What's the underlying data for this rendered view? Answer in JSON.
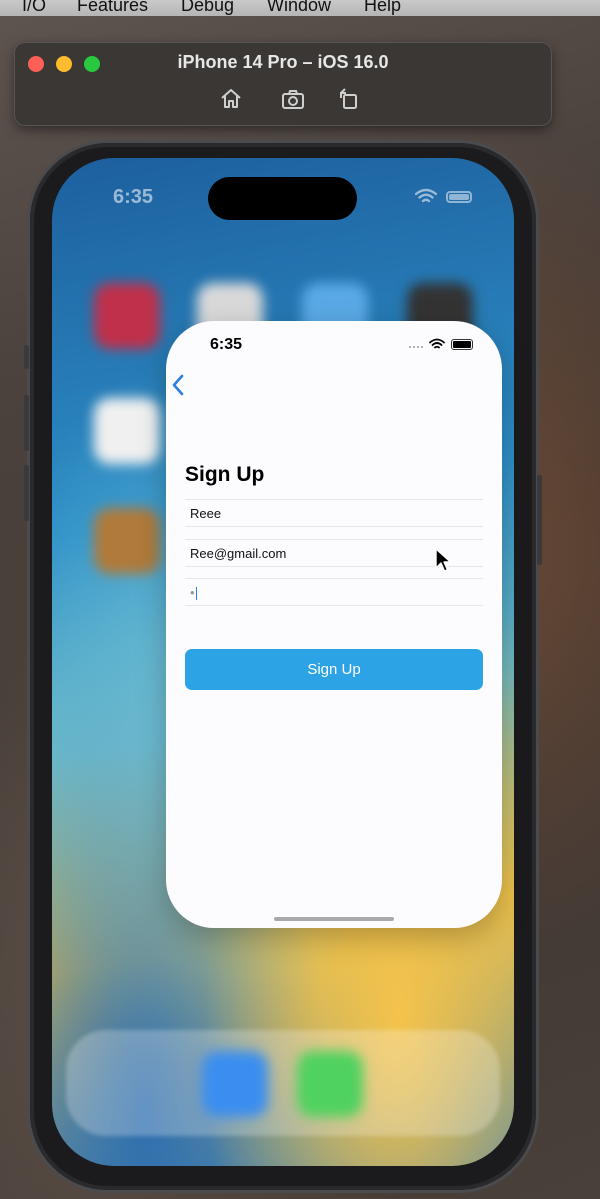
{
  "menubar": {
    "items": [
      "I/O",
      "Features",
      "Debug",
      "Window",
      "Help"
    ]
  },
  "simulator": {
    "title": "iPhone 14 Pro – iOS 16.0",
    "toolbar": [
      "home-icon",
      "screenshot-icon",
      "rotate-icon"
    ]
  },
  "home_screen": {
    "time": "6:35"
  },
  "app": {
    "status_time": "6:35",
    "title": "Sign Up",
    "fields": {
      "name": "Reee",
      "email": "Ree@gmail.com",
      "password": "•"
    },
    "signup_button": "Sign Up",
    "accent_color": "#2ba3e5"
  }
}
